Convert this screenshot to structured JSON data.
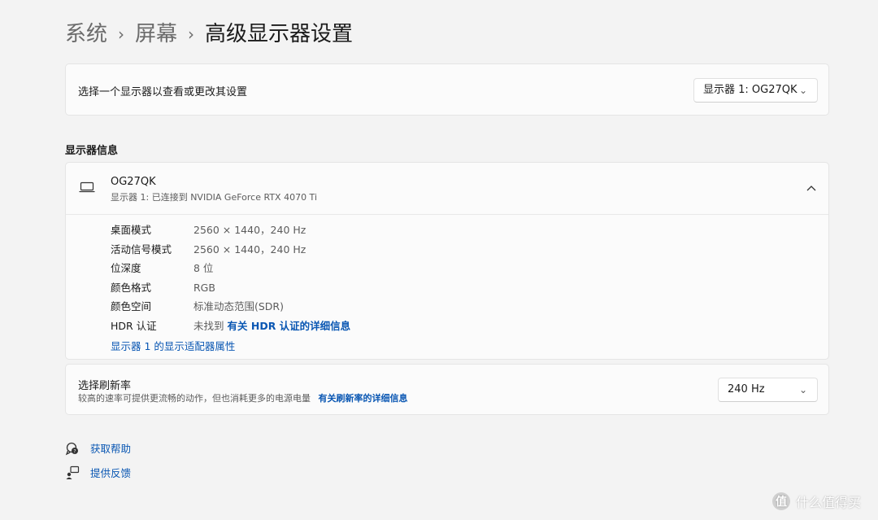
{
  "breadcrumb": {
    "items": [
      "系统",
      "屏幕",
      "高级显示器设置"
    ],
    "separator": "›"
  },
  "select_display": {
    "label": "选择一个显示器以查看或更改其设置",
    "dropdown_value": "显示器 1: OG27QK"
  },
  "display_info": {
    "section_title": "显示器信息",
    "name": "OG27QK",
    "subtitle": "显示器 1: 已连接到 NVIDIA GeForce RTX 4070 Ti",
    "rows": [
      {
        "key": "桌面模式",
        "value": "2560 × 1440，240 Hz"
      },
      {
        "key": "活动信号模式",
        "value": "2560 × 1440，240 Hz"
      },
      {
        "key": "位深度",
        "value": "8 位"
      },
      {
        "key": "颜色格式",
        "value": "RGB"
      },
      {
        "key": "颜色空间",
        "value": "标准动态范围(SDR)"
      },
      {
        "key": "HDR 认证",
        "value": "未找到",
        "link": "有关 HDR 认证的详细信息"
      }
    ],
    "adapter_link": "显示器 1 的显示适配器属性"
  },
  "refresh_rate": {
    "title": "选择刷新率",
    "description": "较高的速率可提供更流畅的动作，但也消耗更多的电源电量",
    "link": "有关刷新率的详细信息",
    "dropdown_value": "240 Hz"
  },
  "help": {
    "get_help": "获取帮助",
    "feedback": "提供反馈"
  },
  "watermark": {
    "logo_char": "值",
    "text": "什么值得买"
  },
  "colors": {
    "background": "#f3f3f3",
    "card": "#fbfbfb",
    "link": "#0a57b3"
  },
  "icons": {
    "chevron": "chevron-down-icon",
    "collapse": "chevron-up-icon",
    "monitor": "laptop-icon",
    "help": "help-icon",
    "feedback": "feedback-icon"
  }
}
